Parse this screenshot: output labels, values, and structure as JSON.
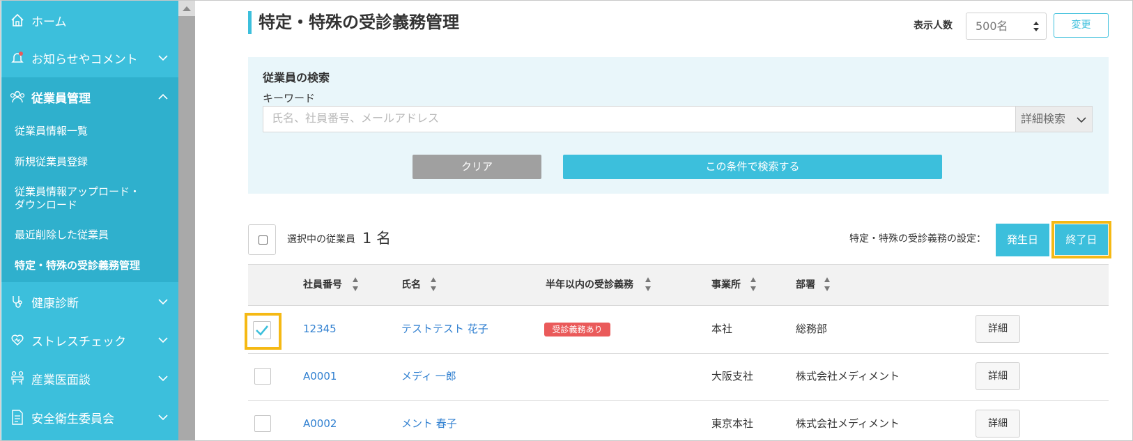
{
  "sidebar": {
    "items": [
      {
        "label": "ホーム",
        "icon": "home-icon"
      },
      {
        "label": "お知らせやコメント",
        "icon": "bell-icon"
      },
      {
        "label": "従業員管理",
        "icon": "people-icon"
      },
      {
        "label": "健康診断",
        "icon": "stethoscope-icon"
      },
      {
        "label": "ストレスチェック",
        "icon": "heart-icon"
      },
      {
        "label": "産業医面談",
        "icon": "meeting-icon"
      },
      {
        "label": "安全衛生委員会",
        "icon": "document-icon"
      }
    ],
    "sub_items": [
      {
        "label": "従業員情報一覧"
      },
      {
        "label": "新規従業員登録"
      },
      {
        "label": "従業員情報アップロード・",
        "label2": "ダウンロード"
      },
      {
        "label": "最近削除した従業員"
      },
      {
        "label": "特定・特殊の受診義務管理"
      }
    ]
  },
  "header": {
    "title": "特定・特殊の受診義務管理",
    "count_label": "表示人数",
    "count_value": "500名",
    "change_label": "変更"
  },
  "search": {
    "heading": "従業員の検索",
    "keyword_label": "キーワード",
    "placeholder": "氏名、社員番号、メールアドレス",
    "advanced_label": "詳細検索",
    "clear_label": "クリア",
    "submit_label": "この条件で検索する"
  },
  "selection": {
    "label": "選択中の従業員",
    "count": "1 名",
    "setting_label": "特定・特殊の受診義務の設定：",
    "start_label": "発生日",
    "end_label": "終了日"
  },
  "table": {
    "headers": [
      "社員番号",
      "氏名",
      "半年以内の受診義務",
      "事業所",
      "部署"
    ],
    "detail_label": "詳細",
    "rows": [
      {
        "id": "12345",
        "name": "テストテスト 花子",
        "duty": "受診義務あり",
        "office": "本社",
        "dept": "総務部",
        "checked": true
      },
      {
        "id": "A0001",
        "name": "メディ 一郎",
        "duty": "",
        "office": "大阪支社",
        "dept": "株式会社メディメント",
        "checked": false
      },
      {
        "id": "A0002",
        "name": "メント 春子",
        "duty": "",
        "office": "東京本社",
        "dept": "株式会社メディメント",
        "checked": false
      }
    ]
  },
  "colors": {
    "accent": "#3cbfdc",
    "highlight": "#f5b914",
    "badge": "#ea5a5a",
    "link": "#2f7fd0"
  }
}
